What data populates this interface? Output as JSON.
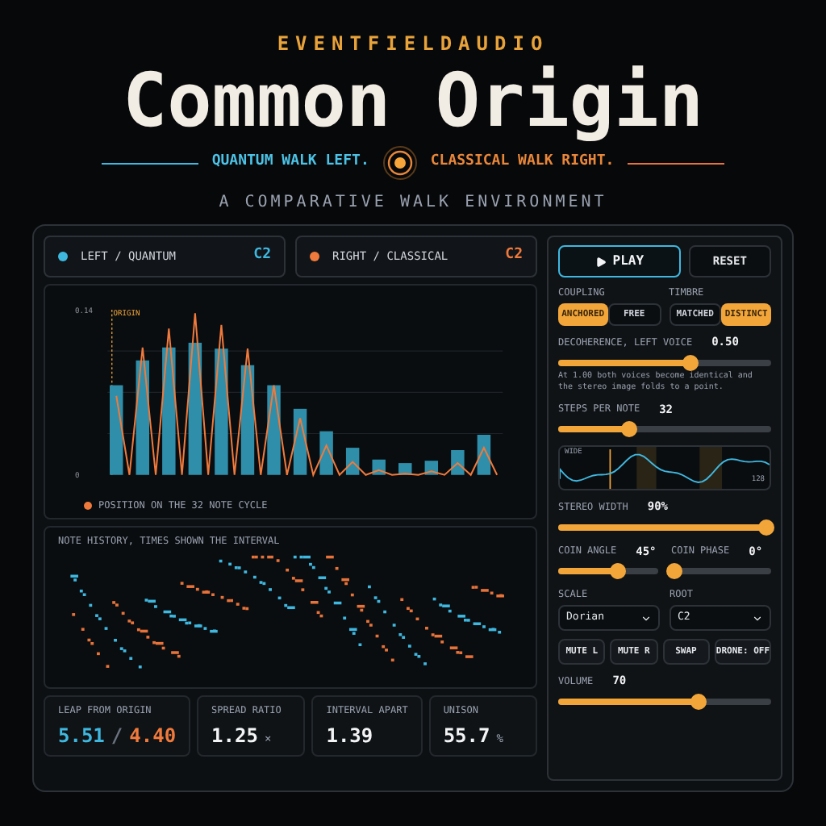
{
  "brand": "EVENTFIELDAUDIO",
  "title": "Common Origin",
  "taglines": {
    "left": "QUANTUM WALK LEFT.",
    "right": "CLASSICAL WALK RIGHT."
  },
  "subtitle": "A COMPARATIVE WALK ENVIRONMENT",
  "voices": [
    {
      "label": "LEFT / QUANTUM",
      "note": "C2",
      "color": "#3fb8e0"
    },
    {
      "label": "RIGHT / CLASSICAL",
      "note": "C2",
      "color": "#f07a3c"
    }
  ],
  "chart": {
    "chart_data": {
      "type": "bar",
      "ylim": [
        0,
        0.14
      ],
      "yticks": [
        0,
        0.14
      ],
      "annotations": [
        "ORIGIN"
      ],
      "series": [
        {
          "color": "#2f8fab",
          "values": [
            0.076,
            null,
            0.097,
            null,
            0.108,
            null,
            0.112,
            null,
            0.107,
            null,
            0.093,
            null,
            0.076,
            null,
            0.056,
            null,
            0.037,
            null,
            0.023,
            null,
            0.013,
            null,
            0.01,
            null,
            0.012,
            null,
            0.021,
            null,
            0.034,
            null
          ]
        },
        {
          "name": "POSITION ON THE 32 NOTE CYCLE",
          "type": "line",
          "color": "#f07a3c",
          "values": [
            0.067,
            0,
            0.108,
            0,
            0.124,
            0,
            0.137,
            0,
            0.127,
            0,
            0.107,
            0,
            0.076,
            0,
            0.048,
            0,
            0.025,
            0,
            0.011,
            0,
            0.004,
            0,
            0.001,
            0,
            0.003,
            0,
            0.01,
            0,
            0.023,
            0
          ]
        }
      ]
    }
  },
  "history": {
    "title": "NOTE HISTORY, TIMES SHOWN THE INTERVAL"
  },
  "stats": [
    {
      "label": "LEAP FROM ORIGIN",
      "kind": "pair",
      "parts": [
        {
          "text": "5.51",
          "color": "#3fb8e0"
        },
        {
          "text": "/",
          "color": "#6b7280"
        },
        {
          "text": "4.40",
          "color": "#f07a3c"
        }
      ]
    },
    {
      "label": "SPREAD RATIO",
      "kind": "plain",
      "value": "1.25",
      "unit": "×"
    },
    {
      "label": "INTERVAL APART",
      "kind": "plain",
      "value": "1.39"
    },
    {
      "label": "UNISON",
      "kind": "plain",
      "value": "55.7",
      "unit": "%"
    }
  ],
  "transport": {
    "play": "PLAY",
    "reset": "RESET"
  },
  "segments": [
    {
      "label": "COUPLING",
      "options": [
        {
          "label": "ANCHORED",
          "selected": true
        },
        {
          "label": "FREE",
          "selected": false
        }
      ]
    },
    {
      "label": "TIMBRE",
      "options": [
        {
          "label": "MATCHED",
          "selected": false
        },
        {
          "label": "DISTINCT",
          "selected": true
        }
      ]
    }
  ],
  "decoherence": {
    "label": "DECOHERENCE, LEFT VOICE",
    "reading": "0.50",
    "level": 0.62,
    "note": "At 1.00 both voices become identical and the stereo image folds to a point."
  },
  "steps": {
    "label": "STEPS PER NOTE",
    "reading": "32",
    "level": 0.33
  },
  "wave": {
    "top_label": "WIDE",
    "bottom_label": "128"
  },
  "stereo": {
    "label": "STEREO WIDTH",
    "reading": "90%",
    "level": 0.98
  },
  "coins": [
    {
      "label": "COIN ANGLE",
      "reading": "45°",
      "level": 0.6
    },
    {
      "label": "COIN PHASE",
      "reading": "0°",
      "level": 0.03
    }
  ],
  "selects": [
    {
      "label": "SCALE",
      "value": "Dorian"
    },
    {
      "label": "ROOT",
      "value": "C2"
    }
  ],
  "buttons": [
    "MUTE L",
    "MUTE R",
    "SWAP",
    "DRONE: OFF"
  ],
  "volume": {
    "label": "VOLUME",
    "reading": "70",
    "level": 0.66
  }
}
